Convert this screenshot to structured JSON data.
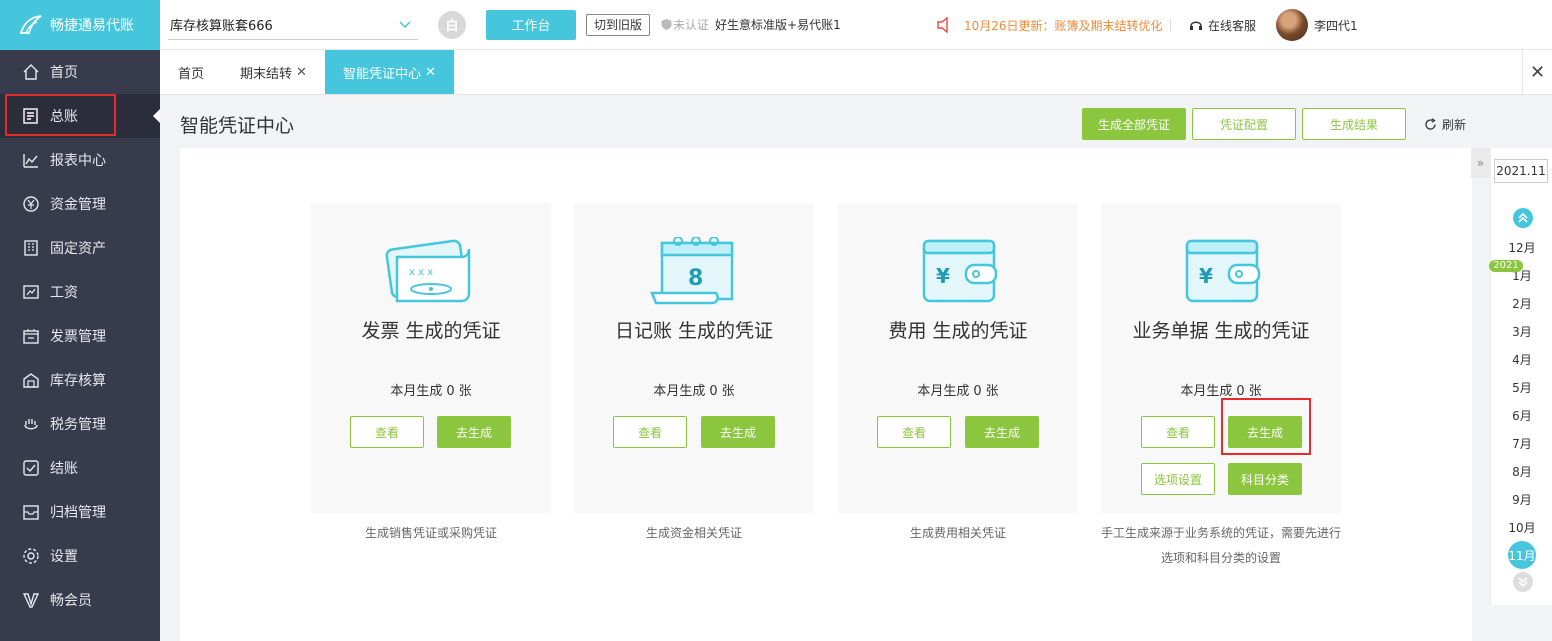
{
  "app": {
    "name": "畅捷通易代账",
    "account_set": "库存核算账套666",
    "circle_btn": "白",
    "workbench": "工作台",
    "old_version": "切到旧版",
    "unverified": "未认证",
    "edition": "好生意标准版+易代账1",
    "notice": "10月26日更新：账簿及期末结转优化",
    "online_service": "在线客服",
    "user": "李四代1"
  },
  "sidebar": {
    "items": [
      {
        "label": "首页",
        "icon": "home-icon"
      },
      {
        "label": "总账",
        "icon": "ledger-icon",
        "active": true
      },
      {
        "label": "报表中心",
        "icon": "chart-icon"
      },
      {
        "label": "资金管理",
        "icon": "yen-coin-icon"
      },
      {
        "label": "固定资产",
        "icon": "building-icon"
      },
      {
        "label": "工资",
        "icon": "salary-icon"
      },
      {
        "label": "发票管理",
        "icon": "invoice-icon"
      },
      {
        "label": "库存核算",
        "icon": "warehouse-icon"
      },
      {
        "label": "税务管理",
        "icon": "hand-icon"
      },
      {
        "label": "结账",
        "icon": "checkout-icon"
      },
      {
        "label": "归档管理",
        "icon": "archive-icon"
      },
      {
        "label": "设置",
        "icon": "gear-icon"
      },
      {
        "label": "畅会员",
        "icon": "vip-icon"
      }
    ]
  },
  "tabs": [
    {
      "label": "首页",
      "closable": false
    },
    {
      "label": "期末结转",
      "closable": true
    },
    {
      "label": "智能凭证中心",
      "closable": true,
      "active": true
    }
  ],
  "page": {
    "title": "智能凭证中心",
    "generate_all": "生成全部凭证",
    "voucher_config": "凭证配置",
    "generate_result": "生成结果",
    "refresh": "刷新"
  },
  "cards": [
    {
      "title": "发票 生成的凭证",
      "count_label": "本月生成",
      "count": "0",
      "unit": "张",
      "view": "查看",
      "generate": "去生成",
      "desc": "生成销售凭证或采购凭证"
    },
    {
      "title": "日记账 生成的凭证",
      "count_label": "本月生成",
      "count": "0",
      "unit": "张",
      "view": "查看",
      "generate": "去生成",
      "desc": "生成资金相关凭证"
    },
    {
      "title": "费用 生成的凭证",
      "count_label": "本月生成",
      "count": "0",
      "unit": "张",
      "view": "查看",
      "generate": "去生成",
      "desc": "生成费用相关凭证"
    },
    {
      "title": "业务单据 生成的凭证",
      "count_label": "本月生成",
      "count": "0",
      "unit": "张",
      "view": "查看",
      "generate": "去生成",
      "options": "选项设置",
      "classify": "科目分类",
      "desc1": "手工生成来源于业务系统的凭证，需要先进行",
      "desc2": "选项和科目分类的设置"
    }
  ],
  "period": {
    "current": "2021.11",
    "year_badge": "2021",
    "months": [
      "12月",
      "1月",
      "2月",
      "3月",
      "4月",
      "5月",
      "6月",
      "7月",
      "8月",
      "9月",
      "10月",
      "11月"
    ]
  },
  "colors": {
    "cyan": "#46c6dc",
    "green": "#8cc63f",
    "sidebar": "#383b4c",
    "highlight": "#e52b2b",
    "notice": "#ef8b3c"
  }
}
